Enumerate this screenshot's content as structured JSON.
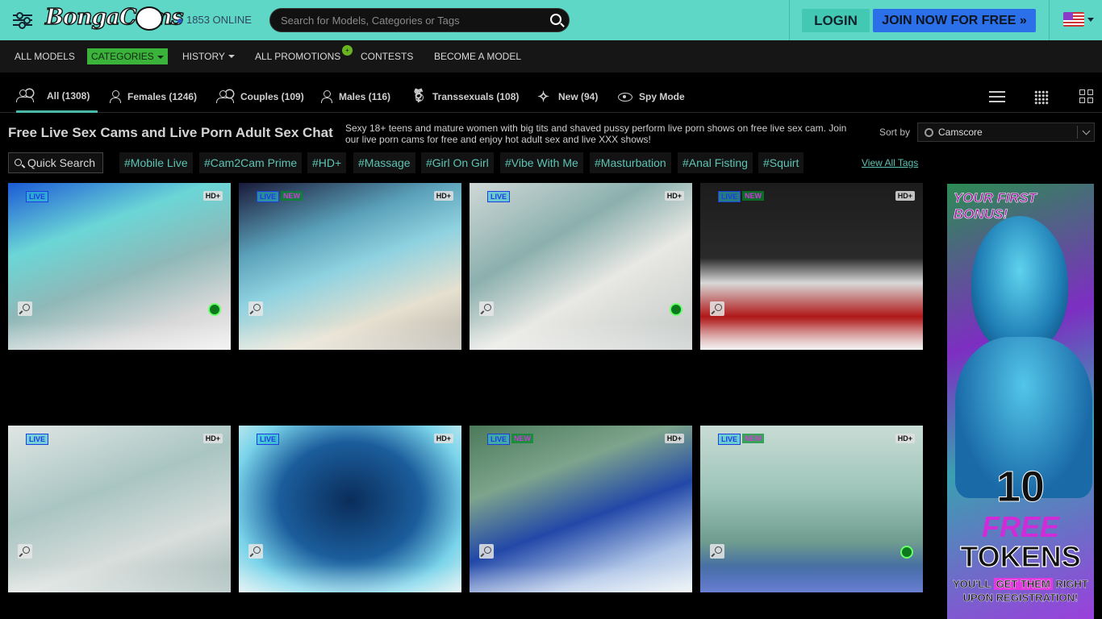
{
  "header": {
    "logo_text": "BongaCams",
    "online_count": "1853 ONLINE",
    "search_placeholder": "Search for Models, Categories or Tags",
    "login_label": "LOGIN",
    "join_label": "JOIN NOW FOR FREE »"
  },
  "nav": {
    "items": [
      {
        "label": "ALL MODELS"
      },
      {
        "label": "CATEGORIES"
      },
      {
        "label": "HISTORY"
      },
      {
        "label": "ALL PROMOTIONS"
      },
      {
        "label": "CONTESTS"
      },
      {
        "label": "BECOME A MODEL"
      }
    ],
    "promo_badge": "+"
  },
  "filters": {
    "tabs": [
      {
        "label": "All (1308)"
      },
      {
        "label": "Females (1246)"
      },
      {
        "label": "Couples (109)"
      },
      {
        "label": "Males (116)"
      },
      {
        "label": "Transsexuals (108)"
      },
      {
        "label": "New (94)"
      },
      {
        "label": "Spy Mode"
      }
    ]
  },
  "page": {
    "title": "Free Live Sex Cams and Live Porn Adult Sex Chat",
    "description": "Sexy 18+ teens and mature women with big tits and shaved pussy perform live porn shows on free live sex cam. Join our live porn cams for free and enjoy hot adult sex and live XXX shows!",
    "sort_label": "Sort by",
    "sort_value": "Camscore"
  },
  "tags": {
    "quick_search": "Quick Search",
    "items": [
      "#Mobile Live",
      "#Cam2Cam Prime",
      "#HD+",
      "#Massage",
      "#Girl On Girl",
      "#Vibe With Me",
      "#Masturbation",
      "#Anal Fisting",
      "#Squirt"
    ],
    "view_all": "View All Tags"
  },
  "thumbs": [
    {
      "live": "LIVE",
      "new": "",
      "hd": "HD+",
      "cam": true,
      "bg": "linear-gradient(160deg,#1b5ad6 0%,#6bd6d6 30%,#8fb8b8 55%,#d8d8d8 80%,#eee 100%)"
    },
    {
      "live": "LIVE",
      "new": "NEW",
      "hd": "HD+",
      "cam": false,
      "bg": "linear-gradient(160deg,#1a1a3a 0%,#5aa0b8 30%,#8fd2e0 50%,#e6e0d0 75%,#b3b0a6 100%)"
    },
    {
      "live": "LIVE",
      "new": "",
      "hd": "HD+",
      "cam": true,
      "bg": "linear-gradient(150deg,#cfd8d6 0%,#8bb0ae 35%,#e8e8e4 60%,#c2c8c6 100%)"
    },
    {
      "live": "LIVE",
      "new": "NEW",
      "hd": "HD+",
      "cam": false,
      "bg": "linear-gradient(180deg,#1c1c1c 0%,#2a2a2a 45%,#d8d8d8 60%,#b01818 80%,#eee 100%)"
    },
    {
      "live": "LIVE",
      "new": "",
      "hd": "HD+",
      "cam": false,
      "bg": "linear-gradient(160deg,#e0e6e4 0%,#a9c5c2 40%,#d8dedc 70%,#9fb6b3 100%)"
    },
    {
      "live": "LIVE",
      "new": "",
      "hd": "HD+",
      "cam": false,
      "bg": "radial-gradient(ellipse at 50% 45%,#0a2d5a 0%,#1b5d9c 45%,#7ad4ea 75%,#d8eef0 100%)"
    },
    {
      "live": "LIVE",
      "new": "NEW",
      "hd": "HD+",
      "cam": false,
      "bg": "linear-gradient(160deg,#4b7a5a 0%,#7da48c 30%,#2248a8 55%,#b0c6e8 80%,#e8f0f4 100%)"
    },
    {
      "live": "LIVE",
      "new": "NEW",
      "hd": "HD+",
      "cam": true,
      "bg": "linear-gradient(180deg,#c9dcd6 0%,#9cc4b8 40%,#6f9c8f 70%,#1a3db8 100%)"
    }
  ],
  "ad": {
    "title": "YOUR FIRST BONUS!",
    "number": "10",
    "free": "FREE",
    "tokens": "TOKENS",
    "sub_line1_a": "YOU'LL ",
    "sub_line1_b": "GET THEM",
    "sub_line1_c": " RIGHT",
    "sub_line2": "UPON REGISTRATION!"
  }
}
